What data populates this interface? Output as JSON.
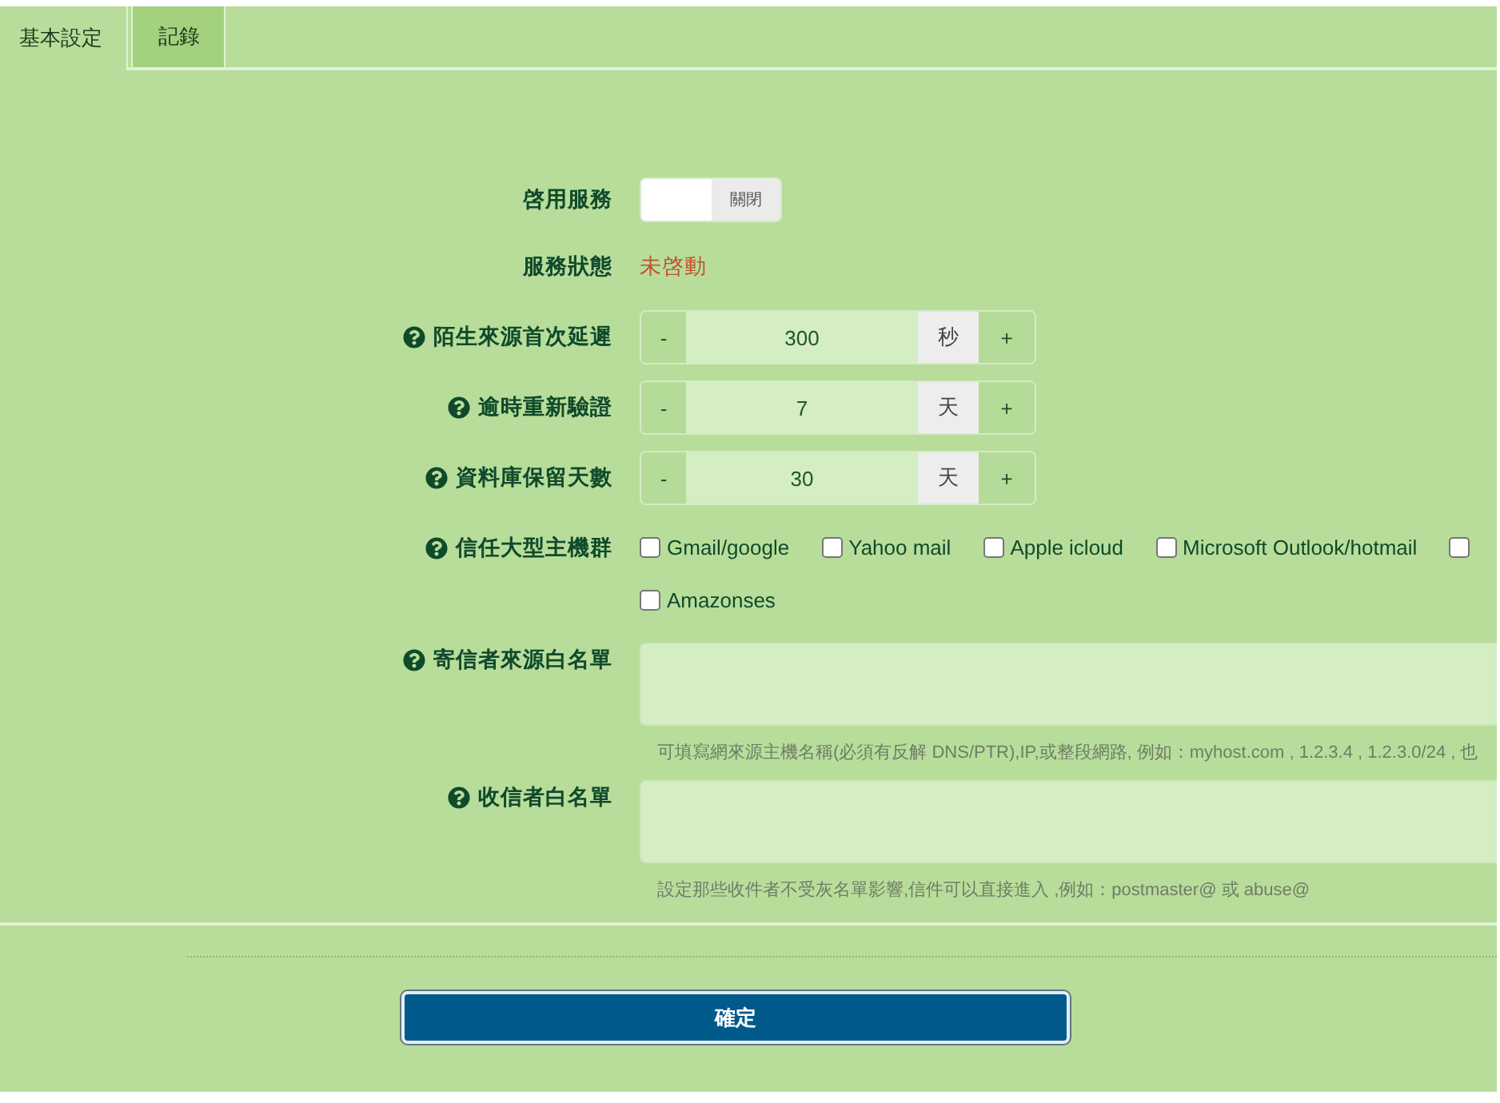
{
  "tabs": [
    {
      "label": "基本設定",
      "selected": true
    },
    {
      "label": "記錄",
      "selected": false
    }
  ],
  "rows": [
    {
      "kind": "toggle",
      "label": "啓用服務",
      "help": false,
      "switch_text": "關閉",
      "on": false
    },
    {
      "kind": "status",
      "label": "服務狀態",
      "help": false,
      "value": "未啓動",
      "running": false
    },
    {
      "kind": "stepper",
      "label": "陌生來源首次延遲",
      "help": true,
      "minus": "-",
      "value": "300",
      "unit": "秒",
      "plus": "+"
    },
    {
      "kind": "stepper",
      "label": "逾時重新驗證",
      "help": true,
      "minus": "-",
      "value": "7",
      "unit": "天",
      "plus": "+"
    },
    {
      "kind": "stepper",
      "label": "資料庫保留天數",
      "help": true,
      "minus": "-",
      "value": "30",
      "unit": "天",
      "plus": "+"
    },
    {
      "kind": "checkboxes",
      "label": "信任大型主機群",
      "help": true,
      "options": [
        {
          "label": "Gmail/google",
          "checked": false
        },
        {
          "label": "Yahoo mail",
          "checked": false
        },
        {
          "label": "Apple icloud",
          "checked": false
        },
        {
          "label": "Microsoft Outlook/hotmail",
          "checked": false
        },
        {
          "checked": false
        },
        {
          "label": "Amazonses",
          "checked": false
        }
      ]
    },
    {
      "kind": "textarea",
      "label": "寄信者來源白名單",
      "help": true,
      "hint": "可填寫網來源主機名稱(必須有反解 DNS/PTR),IP,或整段網路, 例如：myhost.com , 1.2.3.4 , 1.2.3.0/24 , 也"
    },
    {
      "kind": "textarea",
      "label": "收信者白名單",
      "help": true,
      "hint": "設定那些收件者不受灰名單影響,信件可以直接進入 ,例如：postmaster@ 或 abuse@"
    }
  ],
  "submit": {
    "label": "確定"
  }
}
